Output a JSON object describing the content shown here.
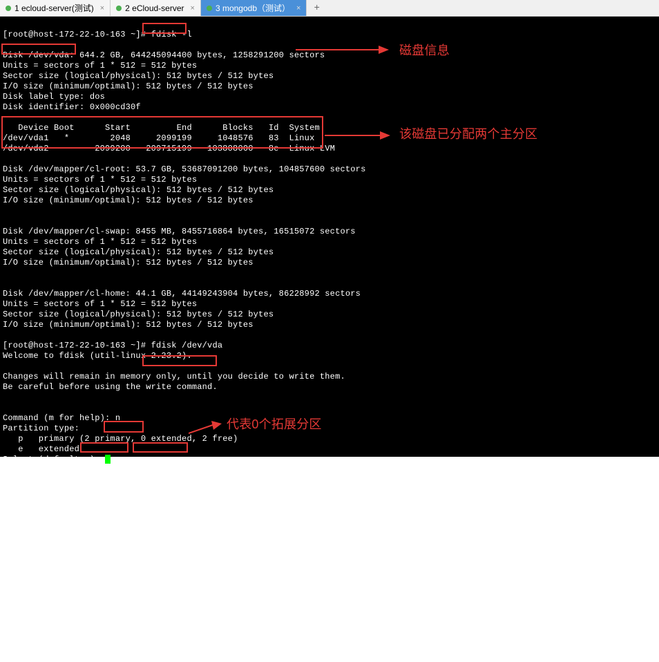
{
  "tabs": {
    "items": [
      {
        "label": "1 ecloud-server(测试)",
        "active": false
      },
      {
        "label": "2 eCloud-server",
        "active": false
      },
      {
        "label": "3 mongodb（测试）",
        "active": true
      }
    ],
    "add": "+"
  },
  "terminal": {
    "prompt1": "[root@host-172-22-10-163 ~]# ",
    "cmd1": "fdisk -l",
    "line_disk_vda": "Disk /dev/vda: 644.2 GB, 644245094400 bytes, 1258291200 sectors",
    "line_units1": "Units = sectors of 1 * 512 = 512 bytes",
    "line_sector1": "Sector size (logical/physical): 512 bytes / 512 bytes",
    "line_io1": "I/O size (minimum/optimal): 512 bytes / 512 bytes",
    "line_label": "Disk label type: dos",
    "line_identifier": "Disk identifier: 0x000cd30f",
    "table_header": "   Device Boot      Start         End      Blocks   Id  System",
    "table_row1": "/dev/vda1   *        2048     2099199     1048576   83  Linux",
    "table_row2": "/dev/vda2         2099200   209715199   103808000   8e  Linux LVM",
    "line_disk_root": "Disk /dev/mapper/cl-root: 53.7 GB, 53687091200 bytes, 104857600 sectors",
    "line_units2": "Units = sectors of 1 * 512 = 512 bytes",
    "line_sector2": "Sector size (logical/physical): 512 bytes / 512 bytes",
    "line_io2": "I/O size (minimum/optimal): 512 bytes / 512 bytes",
    "line_disk_swap": "Disk /dev/mapper/cl-swap: 8455 MB, 8455716864 bytes, 16515072 sectors",
    "line_units3": "Units = sectors of 1 * 512 = 512 bytes",
    "line_sector3": "Sector size (logical/physical): 512 bytes / 512 bytes",
    "line_io3": "I/O size (minimum/optimal): 512 bytes / 512 bytes",
    "line_disk_home": "Disk /dev/mapper/cl-home: 44.1 GB, 44149243904 bytes, 86228992 sectors",
    "line_units4": "Units = sectors of 1 * 512 = 512 bytes",
    "line_sector4": "Sector size (logical/physical): 512 bytes / 512 bytes",
    "line_io4": "I/O size (minimum/optimal): 512 bytes / 512 bytes",
    "prompt2": "[root@host-172-22-10-163 ~]# ",
    "cmd2": "fdisk /dev/vda",
    "welcome": "Welcome to fdisk (util-linux 2.23.2).",
    "changes": "Changes will remain in memory only, until you decide to write them.",
    "careful": "Be careful before using the write command.",
    "cmd_help": "Command (m for help): ",
    "cmd_input": "n",
    "ptype": "Partition type:",
    "ptype_p": "   p   primary (2 primary, 0 extended, 2 free)",
    "ptype_e": "   e   extended",
    "select": "Select (default p): "
  },
  "annotations": {
    "disk_info": "磁盘信息",
    "partition_info": "该磁盘已分配两个主分区",
    "extended_info": "代表0个拓展分区"
  }
}
